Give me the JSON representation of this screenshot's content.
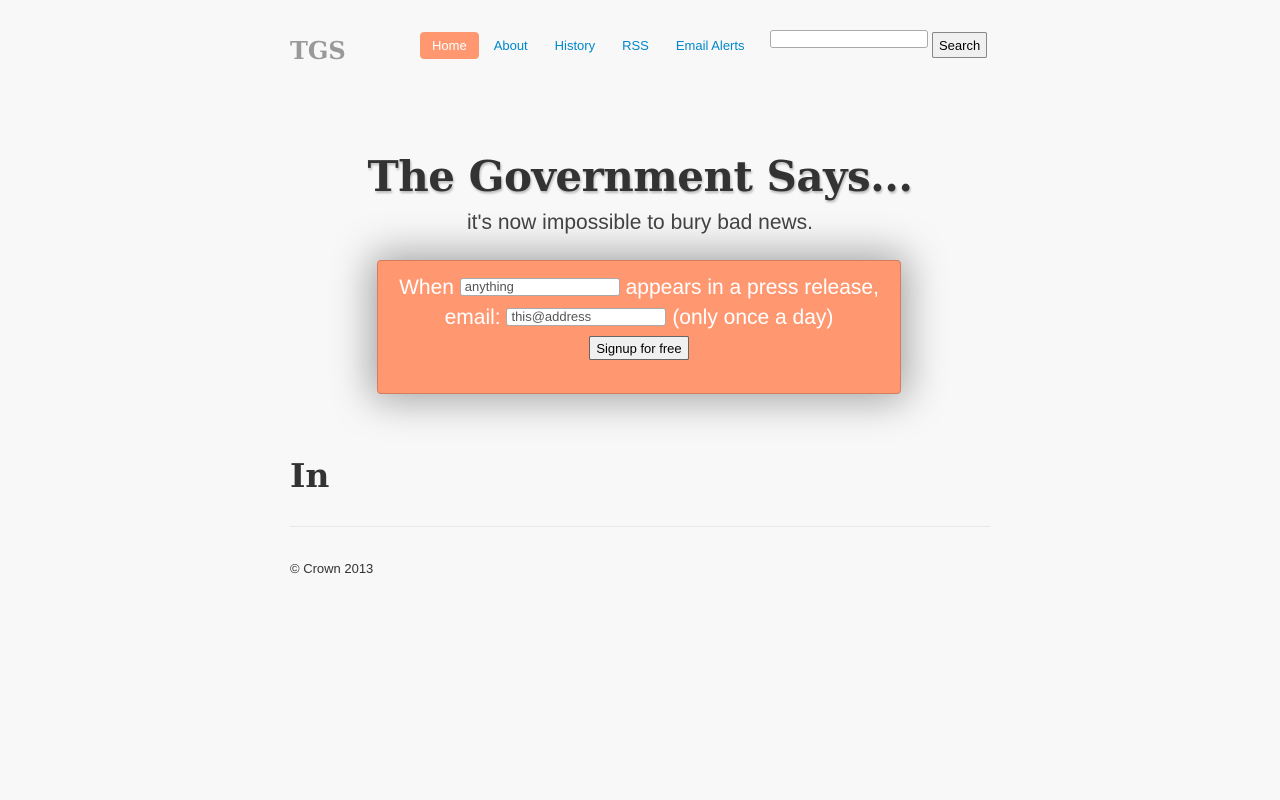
{
  "brand": "TGS",
  "nav": {
    "items": [
      {
        "label": "Home",
        "active": true
      },
      {
        "label": "About"
      },
      {
        "label": "History"
      },
      {
        "label": "RSS"
      },
      {
        "label": "Email Alerts"
      }
    ]
  },
  "search": {
    "value": "",
    "button_label": "Search"
  },
  "hero": {
    "title": "The Government Says...",
    "subtitle": "it's now impossible to bury bad news."
  },
  "signup": {
    "text_when": "When",
    "keyword_value": "anything",
    "text_appears": "appears in a press release,",
    "text_email": "email:",
    "email_value": "this@address",
    "text_frequency": "(only once a day)",
    "button_label": "Signup for free"
  },
  "section": {
    "heading": "In"
  },
  "footer": {
    "text": "© Crown 2013"
  },
  "colors": {
    "accent": "#ff9770",
    "link": "#0088cc",
    "text": "#333333",
    "background": "#f8f8f8"
  }
}
